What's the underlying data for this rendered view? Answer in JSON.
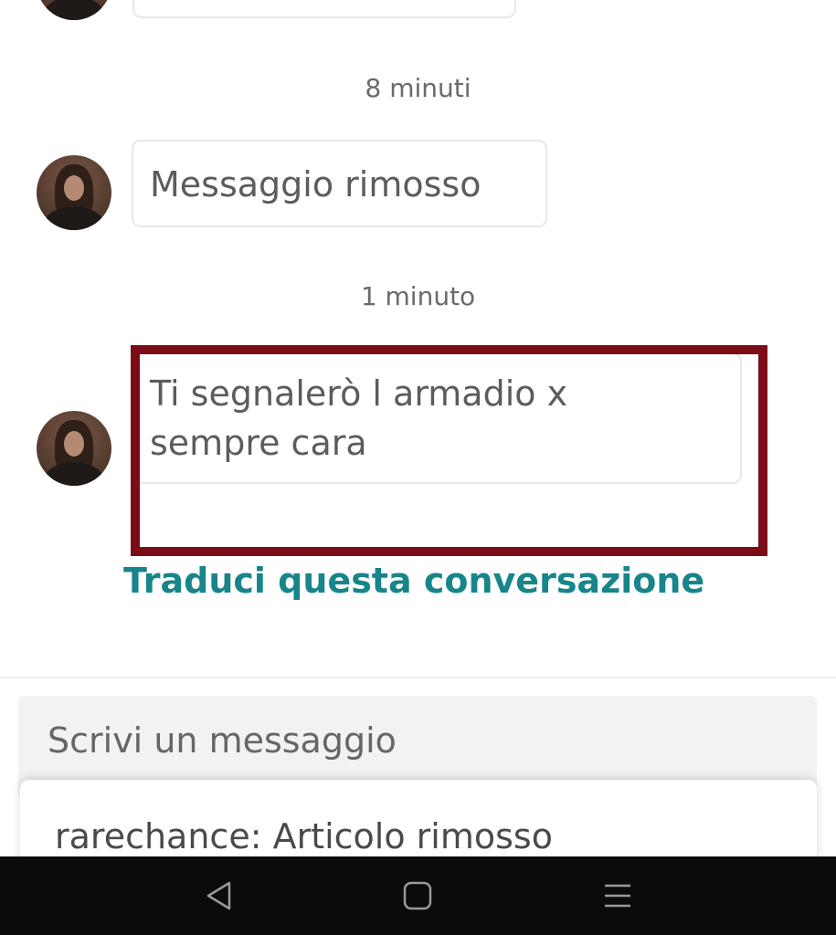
{
  "messages": [
    {
      "timestamp": "8 minuti",
      "text": "Messaggio rimosso"
    },
    {
      "timestamp": "1 minuto",
      "line1": "Ti segnalerò l armadio x",
      "line2": "sempre cara"
    }
  ],
  "translate_link": "Traduci questa conversazione",
  "composer": {
    "placeholder": "Scrivi un messaggio"
  },
  "suggestion": {
    "text": "rarechance: Articolo rimosso"
  },
  "colors": {
    "link": "#17858a",
    "highlight_border": "#7a0d16",
    "navbar": "#0b0b0b"
  },
  "navbar": {
    "icons": [
      "back-triangle-icon",
      "home-square-icon",
      "menu-lines-icon"
    ]
  }
}
